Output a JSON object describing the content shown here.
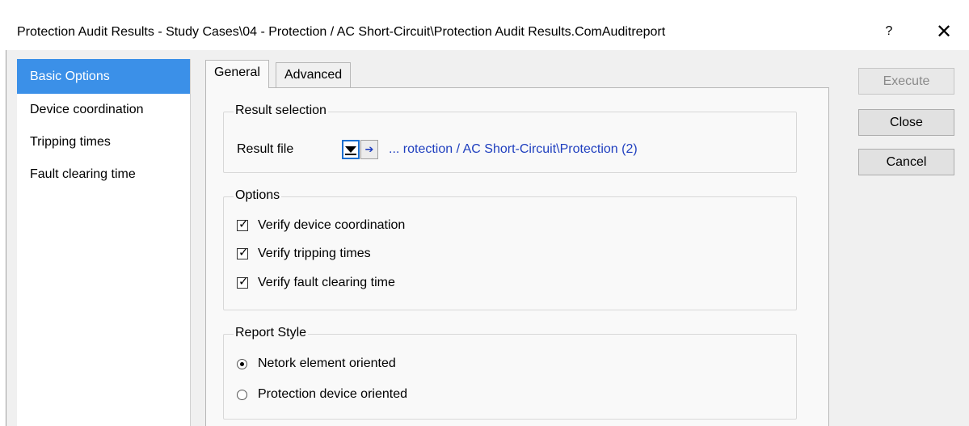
{
  "window": {
    "title": "Protection Audit Results - Study Cases\\04 - Protection / AC Short-Circuit\\Protection Audit Results.ComAuditreport",
    "help_label": "?",
    "close_label": "✕"
  },
  "sidebar": {
    "items": [
      {
        "label": "Basic Options",
        "selected": true
      },
      {
        "label": "Device coordination",
        "selected": false
      },
      {
        "label": "Tripping times",
        "selected": false
      },
      {
        "label": "Fault clearing time",
        "selected": false
      }
    ]
  },
  "tabs": [
    {
      "label": "General",
      "active": true
    },
    {
      "label": "Advanced",
      "active": false
    }
  ],
  "result_selection": {
    "legend": "Result selection",
    "result_file_label": "Result file",
    "result_file_value": "... rotection / AC Short-Circuit\\Protection (2)",
    "arrow_glyph": "➔"
  },
  "options": {
    "legend": "Options",
    "check_glyph": "✓",
    "items": [
      {
        "label": "Verify device coordination",
        "checked": true
      },
      {
        "label": "Verify tripping times",
        "checked": true
      },
      {
        "label": "Verify fault clearing time",
        "checked": true
      }
    ]
  },
  "report_style": {
    "legend": "Report Style",
    "items": [
      {
        "label": "Netork element oriented",
        "selected": true
      },
      {
        "label": "Protection device oriented",
        "selected": false
      }
    ]
  },
  "buttons": {
    "execute": "Execute",
    "close": "Close",
    "cancel": "Cancel"
  },
  "colors": {
    "selection": "#3b90e8",
    "link": "#1f3fbf",
    "focus": "#1a6fd0"
  }
}
